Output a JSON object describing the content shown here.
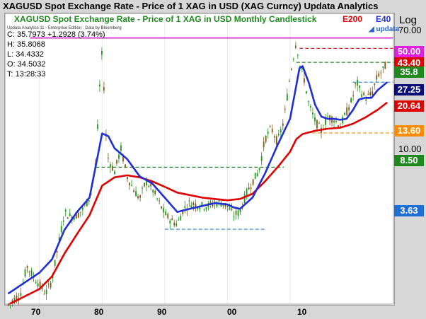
{
  "header": {
    "title": "XAGUSD Spot Exchange Rate - Price of 1 XAG in USD (XAG Curncy)    Updata Analytics",
    "legend_series": "XAGUSD Spot Exchange Rate - Price of 1 XAG in USD Monthly Candlestick",
    "legend_e200": "E200",
    "legend_e40": "E40",
    "axis_scale_label": "Log",
    "logo": "updata"
  },
  "info": {
    "credit": "Updata Analytics 11 - Enterprise Edition : Data by Bloomberg",
    "close": "C: 35.7973  +1.2928 (3.74%)",
    "high": "H: 35.8068",
    "low": "L: 34.4332",
    "open": "O: 34.5032",
    "time": "T: 13:28:33"
  },
  "colors": {
    "background": "#d7d7d7",
    "plot_bg": "#ffffff",
    "candle_up": "#1a9a1a",
    "candle_down": "#7a5a1a",
    "e200": "#e00000",
    "e40": "#1f2fd8",
    "magenta": "#e01ee0",
    "green": "#1e8a1e",
    "orange": "#ff8c00",
    "blue_dash": "#3a8fd8",
    "tag_dark": "#0a0a7a"
  },
  "price_tags": [
    {
      "label": "50.00",
      "value": 50.0,
      "color": "#e01ee0"
    },
    {
      "label": "43.40",
      "value": 43.4,
      "color": "#e00000"
    },
    {
      "label": "35.8",
      "value": 35.8,
      "color": "#1e8a1e"
    },
    {
      "label": "27.25",
      "value": 27.25,
      "color": "#0a0a7a"
    },
    {
      "label": "20.64",
      "value": 20.64,
      "color": "#e00000"
    },
    {
      "label": "13.60",
      "value": 13.6,
      "color": "#ff8c00"
    },
    {
      "label": "8.50",
      "value": 8.5,
      "color": "#1e8a1e"
    },
    {
      "label": "3.63",
      "value": 3.63,
      "color": "#1f6fd8"
    }
  ],
  "chart_data": {
    "type": "line",
    "title": "XAGUSD Spot Exchange Rate - Price of 1 XAG in USD Monthly Candlestick",
    "y_scale": "log",
    "ylim": [
      1.3,
      70
    ],
    "y_ticks": [
      {
        "label": "70.00",
        "value": 70
      },
      {
        "label": "10.00",
        "value": 10
      }
    ],
    "x_ticks": [
      {
        "label": "70",
        "value": 1970
      },
      {
        "label": "80",
        "value": 1980
      },
      {
        "label": "90",
        "value": 1990
      },
      {
        "label": "00",
        "value": 2000
      },
      {
        "label": "10",
        "value": 2010
      }
    ],
    "xlim": [
      1964.5,
      2026.5
    ],
    "series": [
      {
        "name": "XAGUSD Spot Exchange Rate - Price of 1 XAG in USD Monthly Candlestick",
        "x": [
          1965,
          1967,
          1968,
          1969,
          1970,
          1971,
          1972,
          1973,
          1974,
          1975,
          1976,
          1977,
          1978,
          1979,
          1979.8,
          1980.1,
          1980.5,
          1981,
          1982,
          1983,
          1984,
          1985,
          1986,
          1987,
          1988,
          1989,
          1990,
          1991,
          1992,
          1993,
          1994,
          1995,
          1996,
          1997,
          1998,
          1999,
          2000,
          2001,
          2002,
          2003,
          2004,
          2005,
          2006,
          2007,
          2008,
          2009,
          2010,
          2011,
          2011.3,
          2011.8,
          2012,
          2013,
          2014,
          2015,
          2016,
          2017,
          2018,
          2019,
          2020,
          2020.6,
          2021,
          2022,
          2023,
          2024,
          2024.8,
          2025.5
        ],
        "values": [
          1.29,
          1.5,
          2.2,
          1.9,
          1.7,
          1.5,
          1.8,
          2.9,
          4.6,
          4.3,
          4.4,
          4.8,
          5.6,
          9.0,
          35,
          44,
          15,
          9.5,
          8.0,
          11.0,
          7.5,
          6.3,
          5.5,
          7.0,
          6.3,
          5.3,
          4.5,
          4.1,
          3.9,
          4.8,
          5.2,
          5.1,
          5.0,
          5.0,
          5.2,
          5.2,
          5.0,
          4.4,
          4.6,
          5.9,
          7.0,
          8.0,
          12.5,
          14.5,
          12.0,
          16.0,
          30.0,
          48,
          40,
          30,
          32,
          20,
          16,
          14,
          17,
          16.5,
          15,
          18,
          22,
          28,
          25,
          22,
          23,
          30,
          32,
          35.8
        ]
      },
      {
        "name": "E40",
        "x": [
          1965,
          1970,
          1972,
          1974,
          1976,
          1978,
          1980,
          1981,
          1982,
          1984,
          1986,
          1988,
          1990,
          1992,
          1994,
          1996,
          1998,
          2000,
          2001,
          2002,
          2004,
          2006,
          2008,
          2010,
          2011.5,
          2012,
          2013,
          2014,
          2015,
          2016,
          2017,
          2018,
          2019,
          2020,
          2021,
          2022,
          2023,
          2024,
          2025.5
        ],
        "values": [
          1.5,
          2.0,
          2.4,
          3.6,
          4.6,
          5.6,
          13.5,
          13.0,
          11.0,
          9.5,
          7.5,
          6.8,
          5.6,
          4.6,
          4.8,
          5.0,
          5.2,
          5.1,
          4.9,
          4.8,
          5.6,
          7.8,
          11.5,
          16.5,
          33,
          34,
          27,
          20,
          17,
          16.5,
          16.5,
          16.3,
          16.5,
          18.5,
          21.5,
          22,
          22,
          24.5,
          27.25
        ]
      },
      {
        "name": "E200",
        "x": [
          1965,
          1970,
          1972,
          1974,
          1976,
          1978,
          1980,
          1982,
          1984,
          1986,
          1988,
          1990,
          1992,
          1994,
          1996,
          1998,
          2000,
          2002,
          2004,
          2006,
          2008,
          2010,
          2011,
          2012,
          2014,
          2016,
          2018,
          2020,
          2022,
          2024,
          2025.5
        ],
        "values": [
          1.29,
          1.6,
          1.9,
          2.6,
          3.4,
          4.4,
          6.6,
          7.4,
          7.6,
          7.4,
          7.0,
          6.5,
          6.0,
          5.8,
          5.6,
          5.5,
          5.4,
          5.5,
          5.9,
          7.0,
          8.5,
          10.5,
          12.5,
          13.4,
          14.0,
          14.4,
          14.6,
          15.4,
          16.8,
          18.7,
          20.64
        ]
      }
    ],
    "annotations": [
      "50.00",
      "43.40",
      "35.8",
      "27.25",
      "20.64",
      "13.60",
      "8.50",
      "3.63"
    ]
  }
}
